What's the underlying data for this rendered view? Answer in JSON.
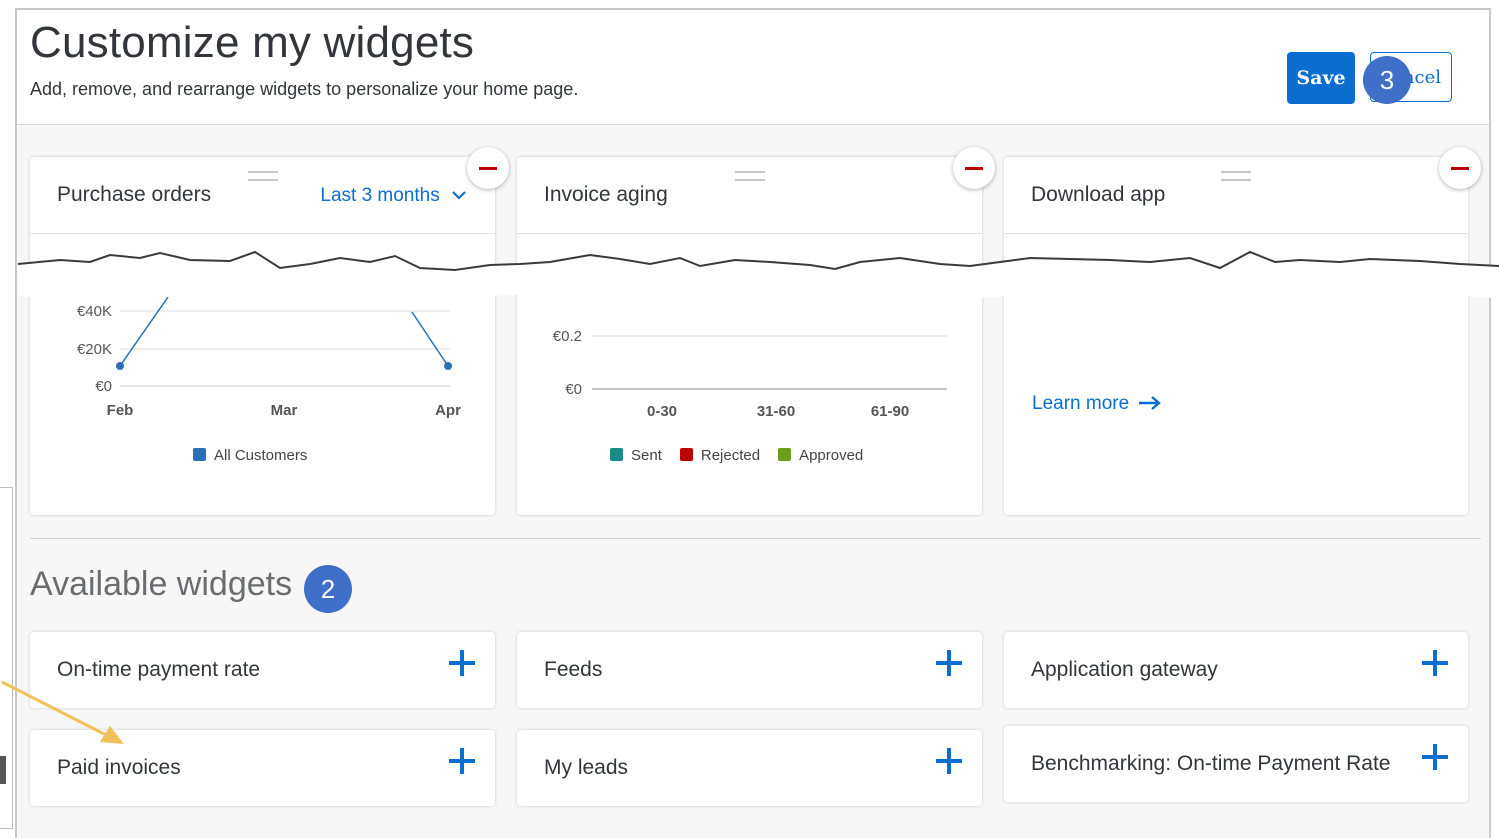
{
  "header": {
    "title": "Customize my widgets",
    "subtitle": "Add, remove, and rearrange widgets to personalize your home page.",
    "save_label": "Save",
    "cancel_label": "ncel"
  },
  "badges": {
    "step2": "2",
    "step3": "3"
  },
  "widgets": {
    "purchase_orders": {
      "title": "Purchase orders",
      "filter": "Last 3 months",
      "legend": "All Customers"
    },
    "invoice_aging": {
      "title": "Invoice aging",
      "legend": [
        "Sent",
        "Rejected",
        "Approved"
      ]
    },
    "download_app": {
      "title": "Download app",
      "learn_more": "Learn more"
    }
  },
  "available": {
    "title": "Available widgets",
    "items": [
      "On-time payment rate",
      "Feeds",
      "Application gateway",
      "Paid invoices",
      "My leads",
      "Benchmarking: On-time Payment Rate"
    ]
  },
  "chart_data": [
    {
      "type": "line",
      "categories": [
        "Feb",
        "Mar",
        "Apr"
      ],
      "y_ticks": [
        "€0",
        "€20K",
        "€40K"
      ],
      "series": [
        {
          "name": "All Customers",
          "values": [
            8000,
            null,
            8000
          ],
          "color": "#2b6fb6"
        }
      ]
    },
    {
      "type": "bar",
      "categories": [
        "0-30",
        "31-60",
        "61-90"
      ],
      "y_ticks": [
        "€0",
        "€0.2"
      ],
      "series": [
        {
          "name": "Sent",
          "color": "#1a8b8b"
        },
        {
          "name": "Rejected",
          "color": "#bb0000"
        },
        {
          "name": "Approved",
          "color": "#6d9e1b"
        }
      ]
    }
  ],
  "colors": {
    "accent": "#0a6ed1",
    "remove": "#bb0000",
    "badge": "#3f6fc8",
    "arrow": "#f2c15a"
  }
}
